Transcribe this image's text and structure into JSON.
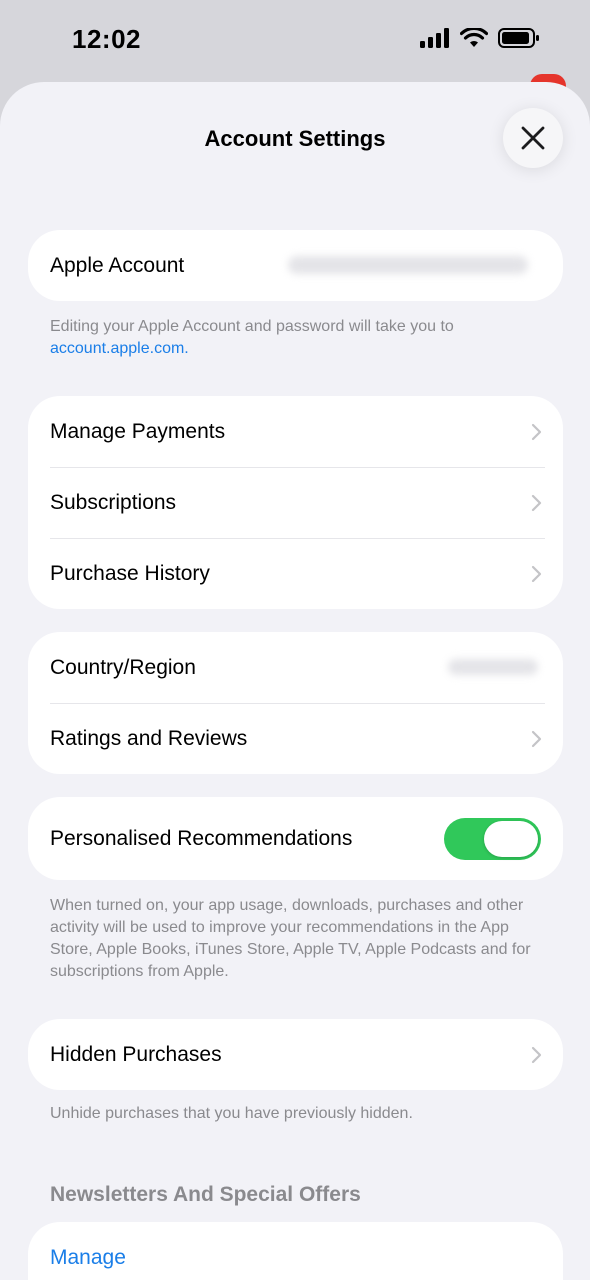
{
  "status_bar": {
    "time": "12:02"
  },
  "sheet": {
    "title": "Account Settings",
    "close_icon": "close-icon"
  },
  "apple_account": {
    "label": "Apple Account",
    "value": "obscured email"
  },
  "apple_account_note": {
    "text": "Editing your Apple Account and password will take you to",
    "link": "account.apple.com."
  },
  "payments_group": {
    "items": [
      {
        "label": "Manage Payments"
      },
      {
        "label": "Subscriptions"
      },
      {
        "label": "Purchase History"
      }
    ]
  },
  "region_group": {
    "country_label": "Country/Region",
    "country_value": "obscured",
    "ratings_label": "Ratings and Reviews"
  },
  "recommendations": {
    "label": "Personalised Recommendations",
    "enabled": true,
    "toggle_color": "#30c85a",
    "note": "When turned on, your app usage, downloads, purchases and other activity will be used to improve your recommendations in the App Store, Apple Books, iTunes Store, Apple TV, Apple Podcasts and for subscriptions from Apple."
  },
  "hidden_purchases": {
    "label": "Hidden Purchases",
    "note": "Unhide purchases that you have previously hidden."
  },
  "newsletters": {
    "header": "Newsletters And Special Offers",
    "manage_label": "Manage",
    "link_color": "#1a7ee8"
  }
}
